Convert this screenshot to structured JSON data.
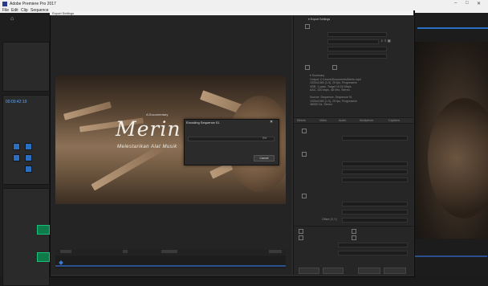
{
  "app": {
    "title": "Adobe Premiere Pro 2017",
    "menu": [
      "File",
      "Edit",
      "Clip",
      "Sequence"
    ]
  },
  "export_dialog": {
    "title": "Export Settings",
    "video_title_small": "A Documentary",
    "video_title": "Merin",
    "video_subtitle": "Melestarikan Alat Musik"
  },
  "encoding_dialog": {
    "title": "Encoding Sequence 01",
    "progress_percent": 0,
    "cancel_label": "Cancel"
  },
  "colors": {
    "accent_blue": "#2a6fc0",
    "track_green": "#16c07a"
  }
}
